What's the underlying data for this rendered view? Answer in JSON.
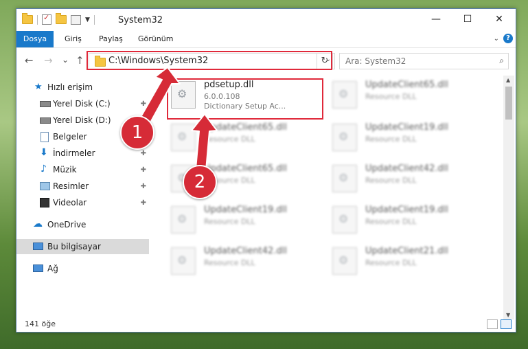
{
  "window": {
    "title": "System32",
    "controls": {
      "minimize": "—",
      "maximize": "☐",
      "close": "✕"
    }
  },
  "ribbon": {
    "tabs": [
      "Dosya",
      "Giriş",
      "Paylaş",
      "Görünüm"
    ],
    "active_tab": "Dosya",
    "help": "?"
  },
  "nav": {
    "back": "←",
    "forward": "→",
    "recent": "⌄",
    "up": "↑",
    "address": "C:\\Windows\\System32",
    "address_dropdown": "⌄",
    "refresh": "↻",
    "search_placeholder": "Ara: System32",
    "search_icon": "⌕"
  },
  "sidebar": {
    "items": [
      {
        "label": "Hızlı erişim",
        "icon": "star-icon",
        "pin": ""
      },
      {
        "label": "Yerel Disk (C:)",
        "icon": "drive-icon",
        "pin": "📌"
      },
      {
        "label": "Yerel Disk (D:)",
        "icon": "drive-icon",
        "pin": "📌"
      },
      {
        "label": "Belgeler",
        "icon": "documents-icon",
        "pin": "📌"
      },
      {
        "label": "İndirmeler",
        "icon": "download-icon",
        "pin": "📌"
      },
      {
        "label": "Müzik",
        "icon": "music-icon",
        "pin": "📌"
      },
      {
        "label": "Resimler",
        "icon": "pictures-icon",
        "pin": "📌"
      },
      {
        "label": "Videolar",
        "icon": "videos-icon",
        "pin": "📌"
      },
      {
        "label": "OneDrive",
        "icon": "cloud-icon",
        "pin": ""
      },
      {
        "label": "Bu bilgisayar",
        "icon": "computer-icon",
        "pin": ""
      },
      {
        "label": "Ağ",
        "icon": "network-icon",
        "pin": ""
      }
    ],
    "selected": "Bu bilgisayar"
  },
  "files": [
    {
      "name": "pdsetup.dll",
      "sub1": "6.0.0.108",
      "sub2": "Dictionary Setup Ac...",
      "highlighted": true
    },
    {
      "name": "UpdateClient65.dll",
      "sub1": "Resource DLL",
      "sub2": ""
    },
    {
      "name": "UpdateClient65.dll",
      "sub1": "Resource DLL",
      "sub2": ""
    },
    {
      "name": "UpdateClient19.dll",
      "sub1": "Resource DLL",
      "sub2": ""
    },
    {
      "name": "UpdateClient65.dll",
      "sub1": "Resource DLL",
      "sub2": ""
    },
    {
      "name": "UpdateClient42.dll",
      "sub1": "Resource DLL",
      "sub2": ""
    },
    {
      "name": "UpdateClient19.dll",
      "sub1": "Resource DLL",
      "sub2": ""
    },
    {
      "name": "UpdateClient19.dll",
      "sub1": "Resource DLL",
      "sub2": ""
    },
    {
      "name": "UpdateClient42.dll",
      "sub1": "Resource DLL",
      "sub2": ""
    },
    {
      "name": "UpdateClient21.dll",
      "sub1": "Resource DLL",
      "sub2": ""
    }
  ],
  "status": {
    "count": "141 öğe"
  },
  "annotations": {
    "badge1": "1",
    "badge2": "2",
    "color": "#d62b37"
  }
}
